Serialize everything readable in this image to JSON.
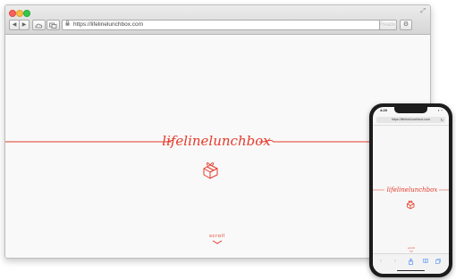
{
  "browser": {
    "nav_back": "◀",
    "nav_forward": "▶",
    "url": "https://lifelinelunchbox.com",
    "reader_label": "Reader",
    "reload_icon": "↻",
    "settings_icon": "⚙",
    "expand_icon": "⤢"
  },
  "site": {
    "logo_text": "lifelinelunchbox",
    "scroll_label": "scroll",
    "brand_color": "#e53a2a"
  },
  "phone": {
    "time": "4:20",
    "status": "▪︎ ◔",
    "url": "https://lifelinelunchbox.com",
    "logo_text": "lifelinelunchbox",
    "scroll_label": "scroll"
  }
}
